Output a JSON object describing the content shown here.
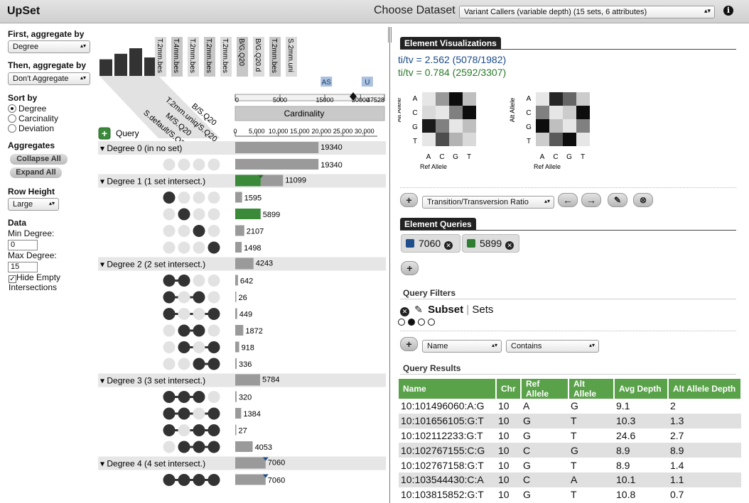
{
  "app": {
    "title": "UpSet",
    "choose_label": "Choose Dataset",
    "dataset": "Variant Callers (variable depth) (15 sets, 6 attributes)"
  },
  "left": {
    "first_agg_label": "First, aggregate by",
    "first_agg_value": "Degree",
    "then_agg_label": "Then, aggregate by",
    "then_agg_value": "Don't Aggregate",
    "sort_label": "Sort by",
    "sort_options": [
      "Degree",
      "Carcinality",
      "Deviation"
    ],
    "sort_selected": 0,
    "aggregates_label": "Aggregates",
    "collapse_label": "Collapse All",
    "expand_label": "Expand All",
    "row_height_label": "Row Height",
    "row_height_value": "Large",
    "data_label": "Data",
    "min_degree_label": "Min Degree:",
    "min_degree_value": "0",
    "max_degree_label": "Max Degree:",
    "max_degree_value": "15",
    "hide_empty_label": "Hide Empty Intersections",
    "hide_empty_checked": true
  },
  "matrix": {
    "set_labels": [
      "T.2mm.bes",
      "T.4mm.bes",
      "T.2mm.bes",
      "T.2mm.bes",
      "T.2mm.bes",
      "B/G.Q20",
      "B/G.Q20.d",
      "T.2mm.bes",
      "S.2mm.uni"
    ],
    "selected_sets": [
      "B/S.Q20",
      "T.2mm.uniq/S.Q20",
      "M/S.Q20",
      "S.default/S.Q20"
    ],
    "set_size_bars": [
      0.45,
      0.6,
      0.75,
      0.5
    ],
    "query_label": "Query",
    "cardinality_label": "Cardinality",
    "top_axis_ticks": [
      "0",
      "5000",
      "15000",
      "30000",
      "47528"
    ],
    "bottom_axis_ticks": [
      "0",
      "5,000",
      "10,000",
      "15,000",
      "20,000",
      "25,000",
      "30,000"
    ],
    "axis_max": 33000,
    "markers": [
      {
        "label": "AS",
        "value": 21000
      },
      {
        "label": "U",
        "value": 30500
      }
    ],
    "rows": [
      {
        "type": "group",
        "label": "Degree 0 (in no set)",
        "value": 19340
      },
      {
        "type": "subset",
        "pattern": [
          0,
          0,
          0,
          0
        ],
        "value": 19340
      },
      {
        "type": "group",
        "label": "Degree 1 (1 set intersect.)",
        "value": 11099,
        "highlight": 5899
      },
      {
        "type": "subset",
        "pattern": [
          1,
          0,
          0,
          0
        ],
        "value": 1595
      },
      {
        "type": "subset",
        "pattern": [
          0,
          1,
          0,
          0
        ],
        "value": 5899,
        "highlight": 5899
      },
      {
        "type": "subset",
        "pattern": [
          0,
          0,
          1,
          0
        ],
        "value": 2107
      },
      {
        "type": "subset",
        "pattern": [
          0,
          0,
          0,
          1
        ],
        "value": 1498
      },
      {
        "type": "group",
        "label": "Degree 2 (2 set intersect.)",
        "value": 4243
      },
      {
        "type": "subset",
        "pattern": [
          1,
          1,
          0,
          0
        ],
        "value": 642
      },
      {
        "type": "subset",
        "pattern": [
          1,
          0,
          1,
          0
        ],
        "value": 26
      },
      {
        "type": "subset",
        "pattern": [
          1,
          0,
          0,
          1
        ],
        "value": 449
      },
      {
        "type": "subset",
        "pattern": [
          0,
          1,
          1,
          0
        ],
        "value": 1872
      },
      {
        "type": "subset",
        "pattern": [
          0,
          1,
          0,
          1
        ],
        "value": 918
      },
      {
        "type": "subset",
        "pattern": [
          0,
          0,
          1,
          1
        ],
        "value": 336
      },
      {
        "type": "group",
        "label": "Degree 3 (3 set intersect.)",
        "value": 5784
      },
      {
        "type": "subset",
        "pattern": [
          1,
          1,
          1,
          0
        ],
        "value": 320
      },
      {
        "type": "subset",
        "pattern": [
          1,
          1,
          0,
          1
        ],
        "value": 1384
      },
      {
        "type": "subset",
        "pattern": [
          1,
          0,
          1,
          1
        ],
        "value": 27
      },
      {
        "type": "subset",
        "pattern": [
          0,
          1,
          1,
          1
        ],
        "value": 4053
      },
      {
        "type": "group",
        "label": "Degree 4 (4 set intersect.)",
        "value": 7060,
        "marker": true
      },
      {
        "type": "subset",
        "pattern": [
          1,
          1,
          1,
          1
        ],
        "value": 7060,
        "marker": true
      }
    ]
  },
  "right": {
    "element_viz_label": "Element Visualizations",
    "titv1": "ti/tv = 2.562 (5078/1982)",
    "titv1_color": "#1a4a8a",
    "titv2": "ti/tv = 0.784 (2592/3307)",
    "titv2_color": "#2a7a2a",
    "heatmap_row_labels": [
      "A",
      "C",
      "G",
      "T"
    ],
    "heatmap_col_labels": [
      "A",
      "C",
      "G",
      "T"
    ],
    "heatmap_ylabel": "Alt Allele",
    "heatmap_xlabel": "Ref Allele",
    "heatmap1": [
      [
        0.9,
        0.6,
        0.05,
        0.75
      ],
      [
        0.85,
        0.9,
        0.5,
        0.05
      ],
      [
        0.1,
        0.5,
        0.9,
        0.75
      ],
      [
        0.9,
        0.3,
        0.7,
        0.85
      ]
    ],
    "heatmap2": [
      [
        0.9,
        0.15,
        0.4,
        0.8
      ],
      [
        0.5,
        0.9,
        0.8,
        0.05
      ],
      [
        0.05,
        0.75,
        0.9,
        0.5
      ],
      [
        0.8,
        0.35,
        0.05,
        0.9
      ]
    ],
    "viz_type": "Transition/Transversion Ratio",
    "element_queries_label": "Element Queries",
    "queries": [
      {
        "label": "7060",
        "color": "#1f4e8c"
      },
      {
        "label": "5899",
        "color": "#2e7d32"
      }
    ],
    "query_filters_label": "Query Filters",
    "filter_subset": "Subset",
    "filter_sets": "Sets",
    "filter_dots": [
      0,
      1,
      0,
      0
    ],
    "filter_field": "Name",
    "filter_op": "Contains",
    "query_results_label": "Query Results",
    "columns": [
      "Name",
      "Chr",
      "Ref Allele",
      "Alt Allele",
      "Avg Depth",
      "Alt Allele Depth"
    ],
    "results": [
      [
        "10:101496060:A:G",
        "10",
        "A",
        "G",
        "9.1",
        "2"
      ],
      [
        "10:101656105:G:T",
        "10",
        "G",
        "T",
        "10.3",
        "1.3"
      ],
      [
        "10:102112233:G:T",
        "10",
        "G",
        "T",
        "24.6",
        "2.7"
      ],
      [
        "10:102767155:C:G",
        "10",
        "C",
        "G",
        "8.9",
        "8.9"
      ],
      [
        "10:102767158:G:T",
        "10",
        "G",
        "T",
        "8.9",
        "1.4"
      ],
      [
        "10:103544430:C:A",
        "10",
        "C",
        "A",
        "10.1",
        "1.1"
      ],
      [
        "10:103815852:G:T",
        "10",
        "G",
        "T",
        "10.8",
        "0.7"
      ]
    ]
  }
}
